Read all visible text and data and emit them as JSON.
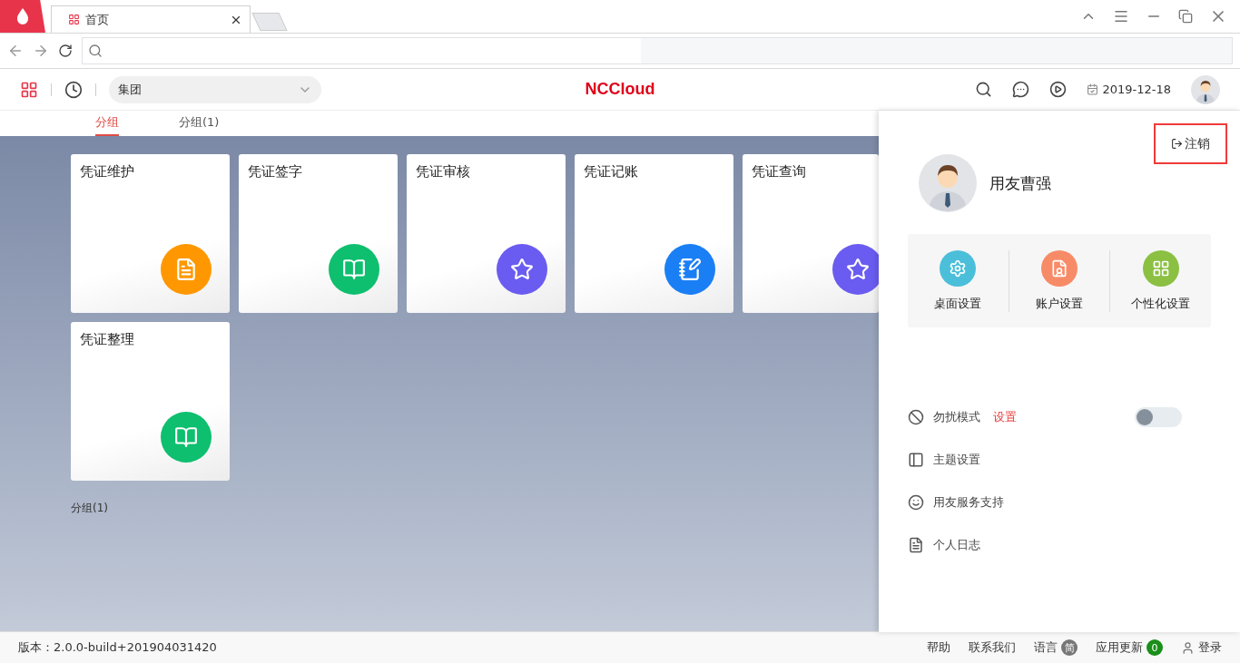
{
  "browser": {
    "tab_title": "首页"
  },
  "header": {
    "org_select": "集团",
    "logo": "NCCloud",
    "date": "2019-12-18"
  },
  "group_tabs": [
    {
      "label": "分组",
      "selected": true
    },
    {
      "label": "分组(1)",
      "selected": false
    }
  ],
  "cards": [
    {
      "title": "凭证维护",
      "kind": "doc",
      "color": "#ff9800"
    },
    {
      "title": "凭证签字",
      "kind": "book",
      "color": "#0dbf6e"
    },
    {
      "title": "凭证审核",
      "kind": "review",
      "color": "#6a5cf0"
    },
    {
      "title": "凭证记账",
      "kind": "note",
      "color": "#1a7ff5"
    },
    {
      "title": "凭证查询",
      "kind": "review",
      "color": "#6a5cf0"
    },
    {
      "title": "凭证整理",
      "kind": "book",
      "color": "#0dbf6e"
    }
  ],
  "section_label": "分组(1)",
  "panel": {
    "logout": "注销",
    "user_name": "用友曹强",
    "shortcuts": [
      {
        "label": "桌面设置",
        "kind": "gear",
        "color": "#4bbfda"
      },
      {
        "label": "账户设置",
        "kind": "card",
        "color": "#f88b67"
      },
      {
        "label": "个性化设置",
        "kind": "grid",
        "color": "#8bc043"
      }
    ],
    "settings": [
      {
        "kind": "toggle",
        "label": "勿扰模式",
        "link": "设置",
        "on": false
      },
      {
        "kind": "theme",
        "label": "主题设置"
      },
      {
        "kind": "support",
        "label": "用友服务支持"
      },
      {
        "kind": "log",
        "label": "个人日志"
      }
    ]
  },
  "status_bar": {
    "version": "版本：2.0.0-build+201904031420",
    "help": "帮助",
    "contact": "联系我们",
    "language": "语言",
    "language_badge": "简",
    "updates": "应用更新",
    "updates_badge": "0",
    "login": "登录"
  }
}
